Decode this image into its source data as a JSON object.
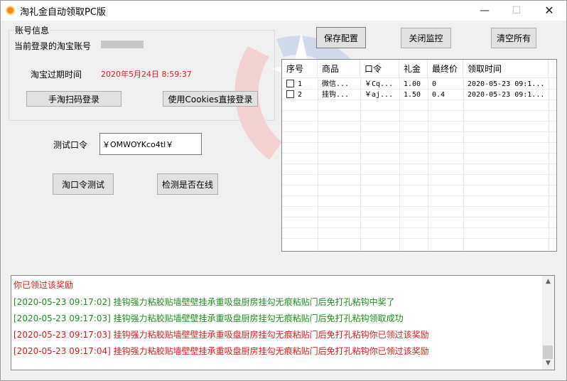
{
  "window": {
    "title": "淘礼金自动领取PC版",
    "controls": {
      "minimize": "—",
      "maximize": "☐",
      "close": "✕"
    }
  },
  "account": {
    "group_title": "账号信息",
    "current_account_label": "当前登录的淘宝账号",
    "expiry_label": "淘宝过期时间",
    "expiry_value": "2020年5月24日  8:59:37",
    "scan_login_button": "手淘扫码登录",
    "cookies_login_button": "使用Cookies直接登录"
  },
  "test": {
    "label": "测试口令",
    "input_value": "￥OMWOYKco4tl￥",
    "test_button": "淘口令测试",
    "check_online_button": "检测是否在线"
  },
  "toolbar": {
    "save_button": "保存配置",
    "stop_button": "关闭监控",
    "clear_button": "清空所有"
  },
  "table": {
    "columns": [
      "序号",
      "商品",
      "口令",
      "礼金",
      "最终价",
      "领取时间"
    ],
    "rows": [
      {
        "index": "1",
        "product": "微信...",
        "code": "￥Cq...",
        "gift": "1.00",
        "final_price": "0",
        "time": "2020-05-23 09:1..."
      },
      {
        "index": "2",
        "product": "挂钩...",
        "code": "￥aj...",
        "gift": "1.50",
        "final_price": "0.4",
        "time": "2020-05-23 09:1..."
      }
    ]
  },
  "log": {
    "lines": [
      {
        "text": "你已领过该奖励",
        "color": "red"
      },
      {
        "text": "[2020-05-23 09:17:02]  挂钩强力粘胶贴墙壁壁挂承重吸盘厨房挂勾无痕粘贴门后免打孔粘钩中奖了",
        "color": "green"
      },
      {
        "text": "[2020-05-23 09:17:03]  挂钩强力粘胶贴墙壁壁挂承重吸盘厨房挂勾无痕粘贴门后免打孔粘钩领取成功",
        "color": "green"
      },
      {
        "text": "[2020-05-23 09:17:03]  挂钩强力粘胶贴墙壁壁挂承重吸盘厨房挂勾无痕粘贴门后免打孔粘钩你已领过该奖励",
        "color": "red"
      },
      {
        "text": "[2020-05-23 09:17:04]  挂钩强力粘胶贴墙壁壁挂承重吸盘厨房挂勾无痕粘贴门后免打孔粘钩你已领过该奖励",
        "color": "red"
      }
    ]
  },
  "colors": {
    "error": "#e11b1b",
    "success": "#1f8d1f",
    "accent": "#f08a1e"
  }
}
